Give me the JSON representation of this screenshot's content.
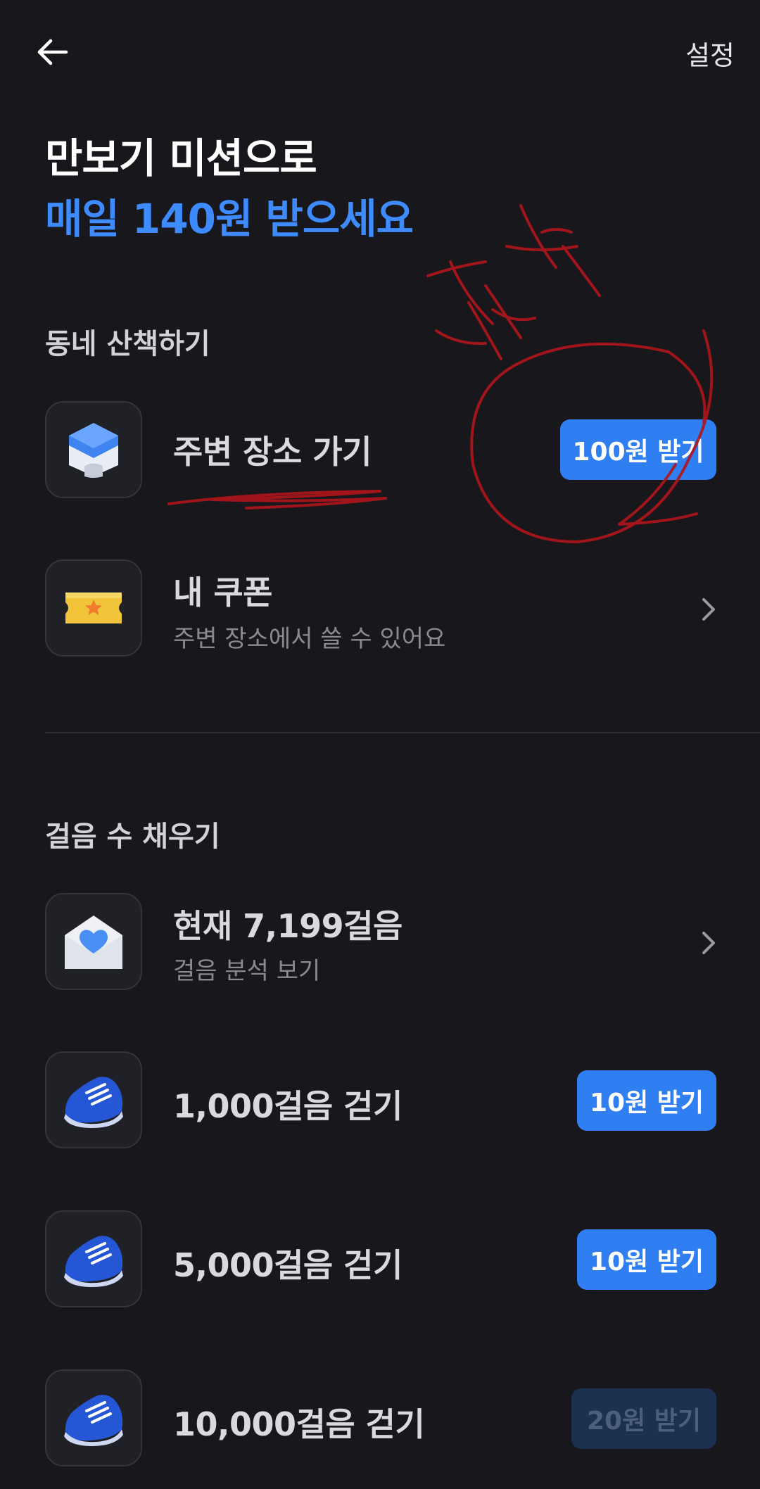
{
  "header": {
    "back_icon": "arrow-left-icon",
    "settings_label": "설정"
  },
  "title": {
    "line1": "만보기 미션으로",
    "line2": "매일 140원 받으세요",
    "accent_color": "#3d8bff"
  },
  "neighborhood": {
    "section_label": "동네 산책하기",
    "items": [
      {
        "icon": "blue-place-cube-icon",
        "title": "주변 장소 가기",
        "button": "100원 받기"
      },
      {
        "icon": "gold-ticket-icon",
        "title": "내 쿠폰",
        "subtitle": "주변 장소에서 쓸 수 있어요"
      }
    ]
  },
  "steps": {
    "section_label": "걸음 수 채우기",
    "current": {
      "icon": "heart-envelope-icon",
      "title": "현재 7,199걸음",
      "subtitle": "걸음 분석 보기"
    },
    "missions": [
      {
        "icon": "blue-sneaker-icon",
        "title": "1,000걸음 걷기",
        "button": "10원 받기",
        "enabled": true
      },
      {
        "icon": "blue-sneaker-icon",
        "title": "5,000걸음 걷기",
        "button": "10원 받기",
        "enabled": true
      },
      {
        "icon": "blue-sneaker-icon",
        "title": "10,000걸음 걷기",
        "button": "20원 받기",
        "enabled": false
      }
    ]
  },
  "colors": {
    "background": "#17171c",
    "button": "#2f7ff2",
    "button_disabled": "#1c3050",
    "scribble": "#b0151b"
  }
}
